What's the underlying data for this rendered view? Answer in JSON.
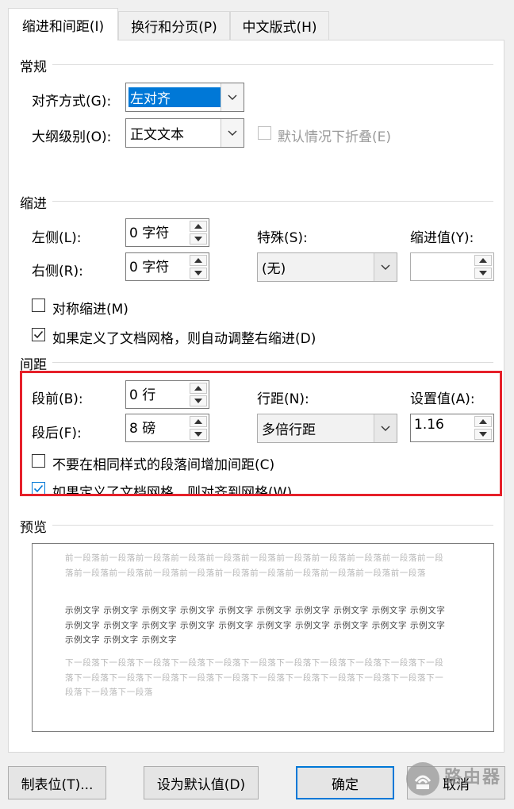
{
  "tabs": [
    "缩进和间距(I)",
    "换行和分页(P)",
    "中文版式(H)"
  ],
  "general": {
    "heading": "常规",
    "alignment_label": "对齐方式(G):",
    "alignment_value": "左对齐",
    "outline_label": "大纲级别(O):",
    "outline_value": "正文文本",
    "collapse_label": "默认情况下折叠(E)"
  },
  "indent": {
    "heading": "缩进",
    "left_label": "左侧(L):",
    "left_value": "0 字符",
    "right_label": "右侧(R):",
    "right_value": "0 字符",
    "special_label": "特殊(S):",
    "special_value": "(无)",
    "indent_value_label": "缩进值(Y):",
    "indent_value": "",
    "mirror_label": "对称缩进(M)",
    "grid_right_label": "如果定义了文档网格，则自动调整右缩进(D)"
  },
  "spacing": {
    "heading": "间距",
    "before_label": "段前(B):",
    "before_value": "0 行",
    "after_label": "段后(F):",
    "after_value": "8 磅",
    "line_label": "行距(N):",
    "line_value": "多倍行距",
    "setting_label": "设置值(A):",
    "setting_value": "1.16",
    "no_space_label": "不要在相同样式的段落间增加间距(C)",
    "snap_grid_label": "如果定义了文档网格，则对齐到网格(W)"
  },
  "preview": {
    "heading": "预览",
    "prev_paragraph": "前一段落前一段落前一段落前一段落前一段落前一段落前一段落前一段落前一段落前一段落前一段落前一段落前一段落前一段落前一段落前一段落前一段落前一段落前一段落前一段落前一段落",
    "sample_text": "示例文字 示例文字 示例文字 示例文字 示例文字 示例文字 示例文字 示例文字 示例文字 示例文字 示例文字 示例文字 示例文字 示例文字 示例文字 示例文字 示例文字 示例文字 示例文字 示例文字 示例文字 示例文字 示例文字",
    "next_paragraph": "下一段落下一段落下一段落下一段落下一段落下一段落下一段落下一段落下一段落下一段落下一段落下一段落下一段落下一段落下一段落下一段落下一段落下一段落下一段落下一段落下一段落下一段落下一段落下一段落"
  },
  "buttons": {
    "tabs_stop": "制表位(T)...",
    "set_default": "设为默认值(D)",
    "ok": "确定",
    "cancel": "取消"
  },
  "watermark": "路由器",
  "colors": {
    "highlight": "#e6202a",
    "selection": "#0078d7",
    "check": "#0078d7"
  }
}
